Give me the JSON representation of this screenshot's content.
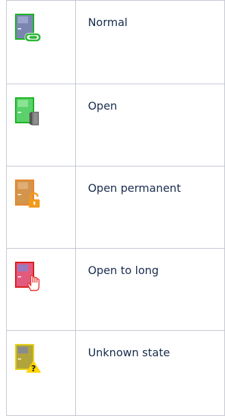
{
  "door_states": [
    {
      "label": "Normal",
      "icon": "door-normal-link-icon",
      "door_color": "#7b86b0",
      "frame_color": "#19b31f",
      "badge_color": "#27b533"
    },
    {
      "label": "Open",
      "icon": "door-open-icon",
      "door_color": "#5ad16a",
      "frame_color": "#19b31f",
      "badge_color": "#777777"
    },
    {
      "label": "Open permanent",
      "icon": "door-open-permanent-lock-icon",
      "door_color": "#d3944c",
      "frame_color": "#e8862a",
      "badge_color": "#f39a1c"
    },
    {
      "label": "Open to long",
      "icon": "door-open-too-long-hand-icon",
      "door_color": "#e25a7e",
      "frame_color": "#d81d1d",
      "badge_color": "#e8312c"
    },
    {
      "label": "Unknown state",
      "icon": "door-unknown-warning-icon",
      "door_color": "#b2a43c",
      "frame_color": "#e6d21d",
      "badge_color": "#ffd600"
    }
  ]
}
